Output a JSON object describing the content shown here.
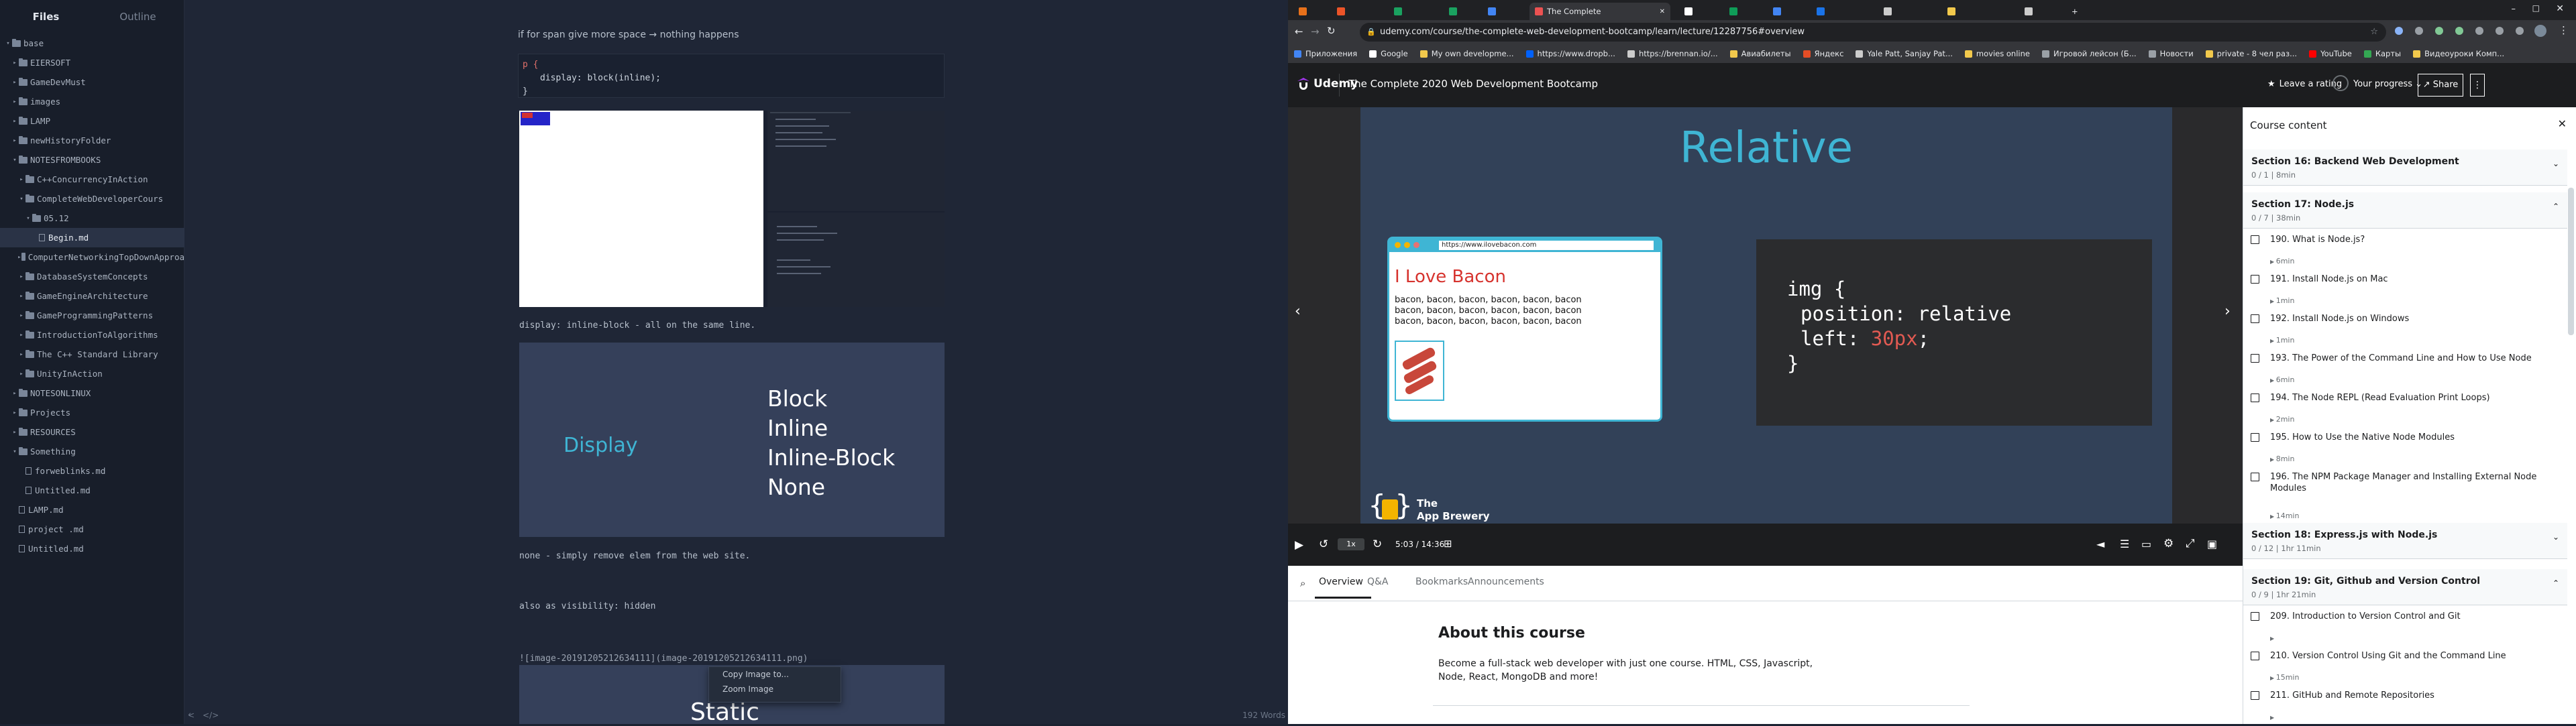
{
  "typora": {
    "tabs": [
      "Files",
      "Outline"
    ],
    "tree": [
      {
        "label": "base",
        "type": "folder",
        "open": true,
        "indent": 0
      },
      {
        "label": "EIERSOFT",
        "type": "folder",
        "open": false,
        "indent": 1
      },
      {
        "label": "GameDevMust",
        "type": "folder",
        "open": false,
        "indent": 1
      },
      {
        "label": "images",
        "type": "folder",
        "open": false,
        "indent": 1
      },
      {
        "label": "LAMP",
        "type": "folder",
        "open": false,
        "indent": 1
      },
      {
        "label": "newHistoryFolder",
        "type": "folder",
        "open": false,
        "indent": 1
      },
      {
        "label": "NOTESFROMBOOKS",
        "type": "folder",
        "open": true,
        "indent": 1
      },
      {
        "label": "C++ConcurrencyInAction",
        "type": "folder",
        "open": false,
        "indent": 2
      },
      {
        "label": "CompleteWebDeveloperCours",
        "type": "folder",
        "open": true,
        "indent": 2
      },
      {
        "label": "05.12",
        "type": "folder",
        "open": true,
        "indent": 3
      },
      {
        "label": "Begin.md",
        "type": "file",
        "open": false,
        "indent": 4,
        "selected": true
      },
      {
        "label": "ComputerNetworkingTopDownApproa",
        "type": "folder",
        "open": false,
        "indent": 2
      },
      {
        "label": "DatabaseSystemConcepts",
        "type": "folder",
        "open": false,
        "indent": 2
      },
      {
        "label": "GameEngineArchitecture",
        "type": "folder",
        "open": false,
        "indent": 2
      },
      {
        "label": "GameProgrammingPatterns",
        "type": "folder",
        "open": false,
        "indent": 2
      },
      {
        "label": "IntroductionToAlgorithms",
        "type": "folder",
        "open": false,
        "indent": 2
      },
      {
        "label": "The C++ Standard Library",
        "type": "folder",
        "open": false,
        "indent": 2
      },
      {
        "label": "UnityInAction",
        "type": "folder",
        "open": false,
        "indent": 2
      },
      {
        "label": "NOTESONLINUX",
        "type": "folder",
        "open": false,
        "indent": 1
      },
      {
        "label": "Projects",
        "type": "folder",
        "open": false,
        "indent": 1
      },
      {
        "label": "RESOURCES",
        "type": "folder",
        "open": false,
        "indent": 1
      },
      {
        "label": "Something",
        "type": "folder",
        "open": true,
        "indent": 1
      },
      {
        "label": "forweblinks.md",
        "type": "file",
        "open": false,
        "indent": 2
      },
      {
        "label": "Untitled.md",
        "type": "file",
        "open": false,
        "indent": 2
      },
      {
        "label": "LAMP.md",
        "type": "file",
        "open": false,
        "indent": 1
      },
      {
        "label": "project .md",
        "type": "file",
        "open": false,
        "indent": 1
      },
      {
        "label": "Untitled.md",
        "type": "file",
        "open": false,
        "indent": 1
      }
    ],
    "text_top": "if for span give more space → nothing happens",
    "code_line1": "p {",
    "code_line2": "display: block(inline);",
    "code_line3": "}",
    "text_inline_block": "display: inline-block - all on the same line.",
    "slide_display": {
      "title": "Display",
      "items": [
        "Block",
        "Inline",
        "Inline-Block",
        "None"
      ]
    },
    "text_none": "none - simply remove elem from the web site.",
    "text_also": "also as  visibility: hidden",
    "text_image": "![image-20191205212634111](image-20191205212634111.png)",
    "context_menu": [
      "Copy Image to...",
      "Zoom Image"
    ],
    "slide_static": "Static",
    "word_count": "192 Words",
    "status_code": "</>",
    "status_left": "<"
  },
  "chrome": {
    "tabs": [
      {
        "label": "",
        "color": "#e8711a"
      },
      {
        "label": "",
        "color": "#ec5428"
      },
      {
        "label": "",
        "color": "#1aa260"
      },
      {
        "label": "",
        "color": "#1aa260"
      },
      {
        "label": "",
        "color": "#4285f4"
      },
      {
        "label": "The Complete",
        "color": "#ec5252",
        "active": true
      },
      {
        "label": "",
        "color": "#ffffff"
      },
      {
        "label": "",
        "color": "#0f9d58"
      },
      {
        "label": "",
        "color": "#4285f4"
      },
      {
        "label": "",
        "color": "#1a73e8"
      },
      {
        "label": "",
        "color": "#cccccc"
      },
      {
        "label": "",
        "color": "#f2c94c"
      },
      {
        "label": "",
        "color": "#cccccc"
      }
    ],
    "url": "udemy.com/course/the-complete-web-development-bootcamp/learn/lecture/12287756#overview",
    "bookmarks": [
      "Приложения",
      "Google",
      "My own developme...",
      "https://www.dropb...",
      "https://brennan.io/...",
      "Авиабилеты",
      "Яндекс",
      "Yale Patt, Sanjay Pat...",
      "movies online",
      "Игровой лейсон (Б...",
      "Новости",
      "private - 8 чел раз...",
      "YouTube",
      "Карты",
      "Видеоуроки Комп..."
    ]
  },
  "udemy": {
    "logo": "Udemy",
    "course_title": "The Complete 2020 Web Development Bootcamp",
    "rating": "Leave a rating",
    "progress": "Your progress",
    "share": "Share",
    "slide_title": "Relative",
    "browser_url": "https://www.ilovebacon.com",
    "browser_heading": "I Love Bacon",
    "browser_text": "bacon, bacon, bacon, bacon, bacon, bacon bacon, bacon, bacon, bacon, bacon, bacon bacon, bacon, bacon, bacon, bacon, bacon",
    "code": [
      "img {",
      "position: relative",
      "left: 30px;",
      "}"
    ],
    "brand_line1": "The",
    "brand_line2": "App Brewery",
    "speed": "1x",
    "time": "5:03 / 14:36",
    "progress_fraction": 0.345,
    "tabs": [
      "Overview",
      "Q&A",
      "Bookmarks",
      "Announcements"
    ],
    "about_title": "About this course",
    "about_text": "Become a full-stack web developer with just one course. HTML, CSS, Javascript, Node, React, MongoDB and more!"
  },
  "panel": {
    "title": "Course content",
    "sections": [
      {
        "title": "Section 16: Backend Web Development",
        "sub": "0 / 1 | 8min"
      },
      {
        "title": "Section 17: Node.js",
        "sub": "0 / 7 | 38min"
      },
      {
        "title": "Section 18: Express.js with Node.js",
        "sub": "0 / 12 | 1hr 11min"
      },
      {
        "title": "Section 19: Git, Github and Version Control",
        "sub": "0 / 9 | 1hr 21min"
      }
    ],
    "lectures17": [
      {
        "title": "190. What is Node.js?",
        "dur": "6min"
      },
      {
        "title": "191. Install Node.js on Mac",
        "dur": "1min"
      },
      {
        "title": "192. Install Node.js on Windows",
        "dur": "1min"
      },
      {
        "title": "193. The Power of the Command Line and How to Use Node",
        "dur": "6min"
      },
      {
        "title": "194. The Node REPL (Read Evaluation Print Loops)",
        "dur": "2min"
      },
      {
        "title": "195. How to Use the Native Node Modules",
        "dur": "8min"
      },
      {
        "title": "196. The NPM Package Manager and Installing External Node Modules",
        "dur": "14min"
      }
    ],
    "lectures19": [
      {
        "title": "209. Introduction to Version Control and Git",
        "dur": ""
      },
      {
        "title": "210. Version Control Using Git and the Command Line",
        "dur": "15min"
      },
      {
        "title": "211. GitHub and Remote Repositories",
        "dur": ""
      }
    ]
  }
}
